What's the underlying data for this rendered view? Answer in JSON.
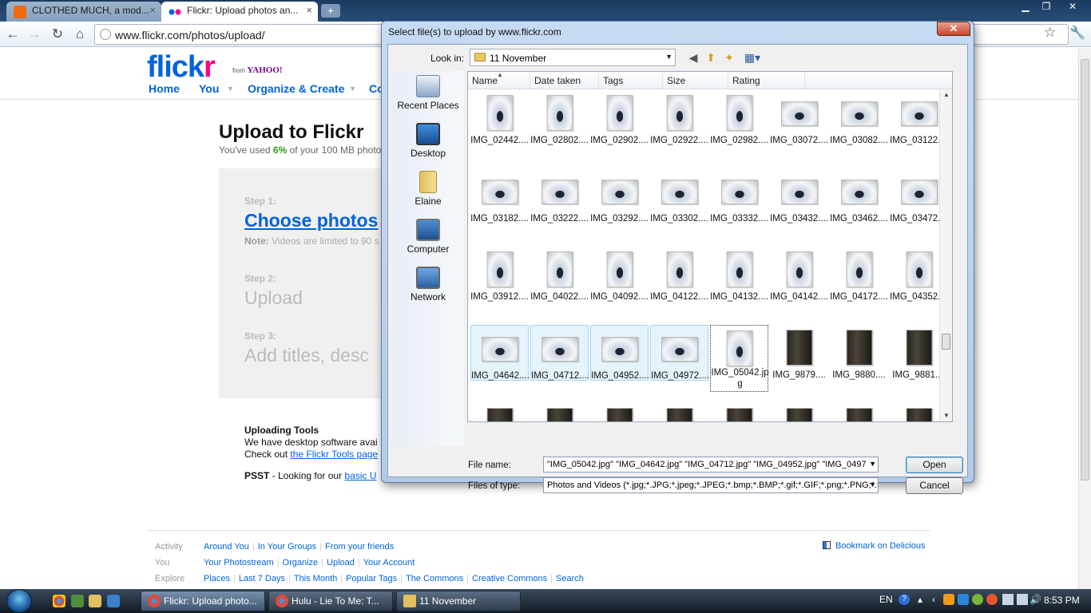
{
  "browser": {
    "tabs": [
      {
        "title": "CLOTHED MUCH, a mod...",
        "favicon_color": "#f06a0d"
      },
      {
        "title": "Flickr: Upload photos an...",
        "favicon_color": "#ff0084"
      }
    ],
    "url": "www.flickr.com/photos/upload/"
  },
  "flickr": {
    "logo_left": "flick",
    "logo_right": "r",
    "from_label": "from",
    "yahoo": "YAHOO!",
    "nav": [
      "Home",
      "You",
      "Organize & Create",
      "Co"
    ],
    "title": "Upload to Flickr",
    "usage_prefix": "You've used ",
    "usage_pct": "6%",
    "usage_suffix": " of your 100 MB photo",
    "step1_label": "Step 1:",
    "step1_text": "Choose photos",
    "note_label": "Note:",
    "note_text": " Videos are limited to 90 s",
    "step2_label": "Step 2:",
    "step2_text": "Upload",
    "step3_label": "Step 3:",
    "step3_text": "Add titles, desc",
    "tools_heading": "Uploading Tools",
    "tools_line1": "We have desktop software avai",
    "tools_line2_prefix": "Check out ",
    "tools_line2_link": "the Flickr Tools page",
    "psst_label": "PSST",
    "psst_text": " - Looking for our ",
    "psst_link": "basic U",
    "footer": {
      "activity_label": "Activity",
      "activity_links": [
        "Around You",
        "In Your Groups",
        "From your friends"
      ],
      "you_label": "You",
      "you_links": [
        "Your Photostream",
        "Organize",
        "Upload",
        "Your Account"
      ],
      "explore_label": "Explore",
      "explore_links": [
        "Places",
        "Last 7 Days",
        "This Month",
        "Popular Tags",
        "The Commons",
        "Creative Commons",
        "Search"
      ],
      "bookmark": "Bookmark on Delicious"
    }
  },
  "dialog": {
    "title": "Select file(s) to upload by www.flickr.com",
    "lookin_label": "Look in:",
    "lookin_value": "11 November",
    "places": [
      "Recent Places",
      "Desktop",
      "Elaine",
      "Computer",
      "Network"
    ],
    "columns": [
      "Name",
      "Date taken",
      "Tags",
      "Size",
      "Rating"
    ],
    "files": [
      [
        "IMG_02442....",
        "IMG_02802....",
        "IMG_02902....",
        "IMG_02922....",
        "IMG_02982....",
        "IMG_03072....",
        "IMG_03082....",
        "IMG_03122...."
      ],
      [
        "IMG_03182....",
        "IMG_03222....",
        "IMG_03292....",
        "IMG_03302....",
        "IMG_03332....",
        "IMG_03432....",
        "IMG_03462....",
        "IMG_03472...."
      ],
      [
        "IMG_03912....",
        "IMG_04022....",
        "IMG_04092....",
        "IMG_04122....",
        "IMG_04132....",
        "IMG_04142....",
        "IMG_04172....",
        "IMG_04352...."
      ],
      [
        "IMG_04642....",
        "IMG_04712....",
        "IMG_04952....",
        "IMG_04972....",
        "IMG_05042.jpg",
        "IMG_9879....",
        "IMG_9880....",
        "IMG_9881...."
      ]
    ],
    "file_name_label": "File name:",
    "file_name_value": "\"IMG_05042.jpg\" \"IMG_04642.jpg\" \"IMG_04712.jpg\" \"IMG_04952.jpg\" \"IMG_0497",
    "file_type_label": "Files of type:",
    "file_type_value": "Photos and Videos (*.jpg;*.JPG;*.jpeg;*.JPEG;*.bmp;*.BMP;*.gif;*.GIF;*.png;*.PNG;*.t",
    "open_label": "Open",
    "cancel_label": "Cancel"
  },
  "taskbar": {
    "buttons": [
      "Flickr: Upload photo...",
      "Hulu - Lie To Me: T...",
      "11 November"
    ],
    "lang": "EN",
    "clock": "8:53 PM"
  }
}
